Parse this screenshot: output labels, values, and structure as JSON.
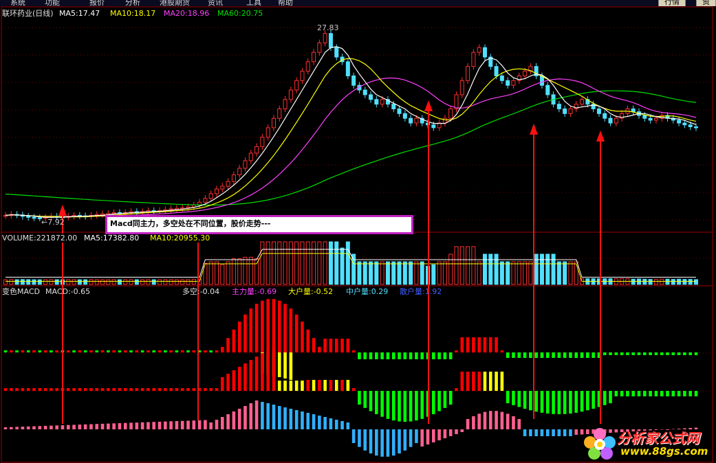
{
  "menu": {
    "items": [
      "系统",
      "功能",
      "报价",
      "分析",
      "港股期货",
      "资讯",
      "工具",
      "帮助"
    ],
    "right_buttons": [
      "行情",
      "资讯"
    ]
  },
  "price_panel": {
    "title": "联环药业(日线)",
    "ma5": "MA5:17.47",
    "ma10": "MA10:18.17",
    "ma20": "MA20:18.96",
    "ma60": "MA60:20.75",
    "high_marker": "27.83",
    "low_marker": "←7.92"
  },
  "volume_panel": {
    "volume": "VOLUME:221872.00",
    "ma5": "MA5:17382.80",
    "ma10": "MA10:20955.30"
  },
  "macd_panel": {
    "title": "变色MACD",
    "macd": "MACD:-0.65",
    "duokong": "多空:-0.04",
    "zhuli": "主力量:-0.69",
    "dahu": "大户量:-0.52",
    "zhonghu": "中户量:0.29",
    "sanhu": "散户量:1.92"
  },
  "annotation": {
    "callout": "Macd同主力，多空处在不同位置，股价走势---"
  },
  "watermark": {
    "title": "分析家公式网",
    "url": "www.88gs.com"
  },
  "colors": {
    "up": "#ff3030",
    "down": "#50e0ff",
    "ma5": "#ffffff",
    "ma10": "#ffff00",
    "ma20": "#ff40ff",
    "ma60": "#00e000",
    "grid": "#800000",
    "hist_red": "#ff0000",
    "hist_green": "#00ff00",
    "hist_yellow": "#ffff00",
    "hist_pink": "#ff6090",
    "hist_cyan": "#30b0ff",
    "arrow": "#ff1010"
  },
  "chart_data": {
    "type": "candlestick",
    "title": "联环药业(日线)",
    "close": [
      8.2,
      8.3,
      8.25,
      8.1,
      8.0,
      7.95,
      7.92,
      8.0,
      8.1,
      8.05,
      8.0,
      8.1,
      8.2,
      8.15,
      8.1,
      8.2,
      8.3,
      8.35,
      8.4,
      8.5,
      8.45,
      8.5,
      8.6,
      8.55,
      8.6,
      8.7,
      8.65,
      8.7,
      8.8,
      8.9,
      8.95,
      9.0,
      9.1,
      9.3,
      9.6,
      10.0,
      10.5,
      11.0,
      11.3,
      11.8,
      12.5,
      13.2,
      14.0,
      14.8,
      15.5,
      16.5,
      17.5,
      18.5,
      19.5,
      20.5,
      21.5,
      22.5,
      23.5,
      24.5,
      25.5,
      26.5,
      27.5,
      26.0,
      25.0,
      24.5,
      23.0,
      22.0,
      21.5,
      21.0,
      20.5,
      20.0,
      20.5,
      20.0,
      19.5,
      19.0,
      18.5,
      18.0,
      18.5,
      18.0,
      17.8,
      17.5,
      18.0,
      18.5,
      19.5,
      21.0,
      22.5,
      24.0,
      25.5,
      26.0,
      25.0,
      24.0,
      23.0,
      22.5,
      22.0,
      22.5,
      23.0,
      23.5,
      24.0,
      23.0,
      22.0,
      21.0,
      20.0,
      19.5,
      19.0,
      19.5,
      20.0,
      20.5,
      20.0,
      19.5,
      19.0,
      18.5,
      18.0,
      18.5,
      19.0,
      19.5,
      19.2,
      18.8,
      18.5,
      18.3,
      18.5,
      18.8,
      18.5,
      18.3,
      18.0,
      17.8,
      17.6,
      17.5
    ],
    "series": [
      {
        "name": "MA5",
        "value": 17.47
      },
      {
        "name": "MA10",
        "value": 18.17
      },
      {
        "name": "MA20",
        "value": 18.96
      },
      {
        "name": "MA60",
        "value": 20.75
      }
    ]
  }
}
